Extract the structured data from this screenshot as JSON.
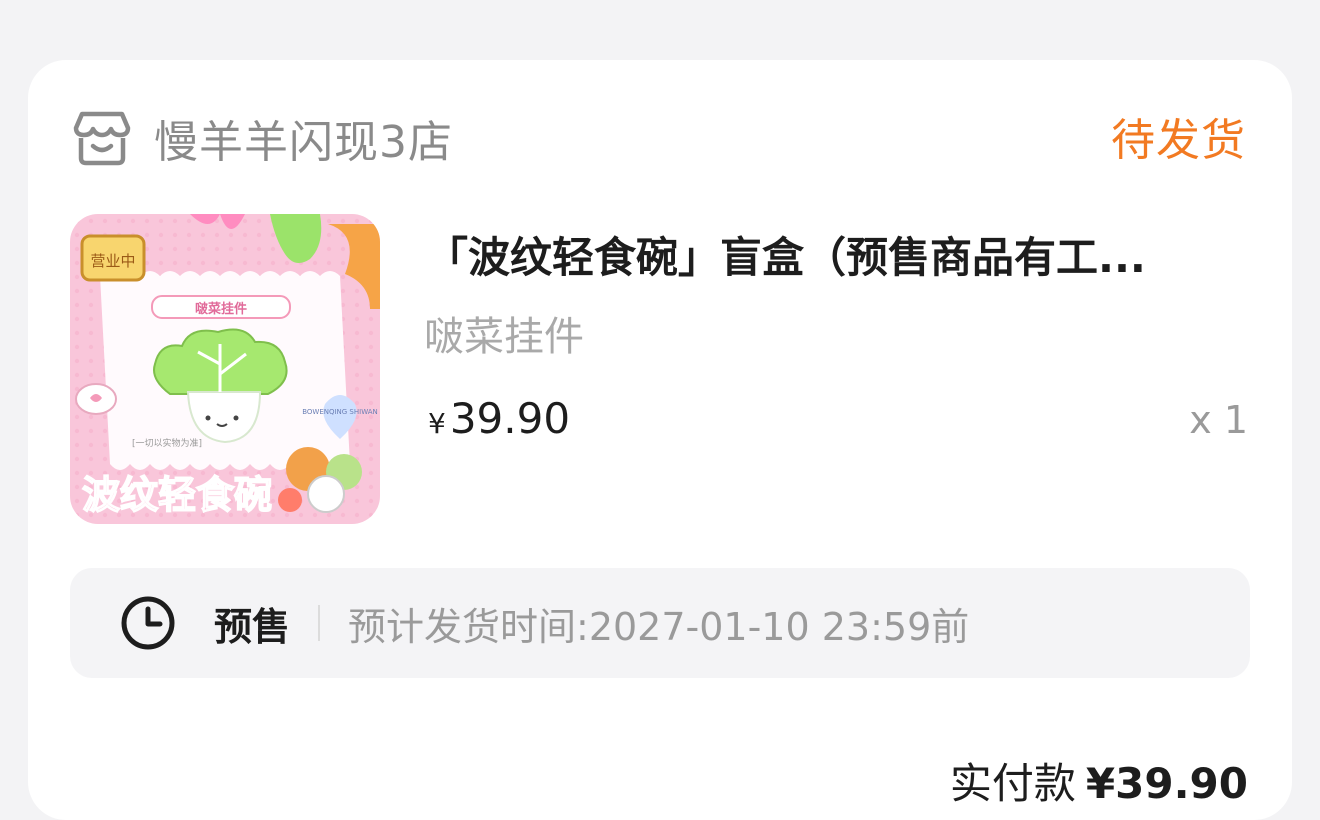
{
  "shop": {
    "name": "慢羊羊闪现3店",
    "icon": "store-icon"
  },
  "order": {
    "status": "待发货",
    "status_color": "#f27a22"
  },
  "product": {
    "title": "「波纹轻食碗」盲盒（预售商品有工...",
    "spec": "啵菜挂件",
    "currency": "¥",
    "price": "39.90",
    "quantity": "x 1",
    "image": {
      "badge": "营业中",
      "tag": "啵菜挂件",
      "note": "[一切以实物为准]",
      "brand": "波纹轻食碗",
      "sticker": "BOWENQING SHIWAN"
    }
  },
  "presale": {
    "icon": "clock-icon",
    "label": "预售",
    "ship_time": "预计发货时间:2027-01-10 23:59前"
  },
  "total": {
    "label": "实付款",
    "amount": "¥39.90"
  }
}
